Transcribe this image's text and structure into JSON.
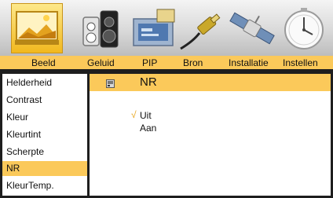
{
  "tabs": [
    "Beeld",
    "Geluid",
    "PIP",
    "Bron",
    "Installatie",
    "Instellen"
  ],
  "menu": {
    "items": [
      "Helderheid",
      "Contrast",
      "Kleur",
      "Kleurtint",
      "Scherpte",
      "NR",
      "KleurTemp."
    ],
    "selected_index": 5
  },
  "detail": {
    "title": "NR",
    "options": [
      "Uit",
      "Aan"
    ],
    "checked_index": 0,
    "check_mark": "√"
  },
  "colors": {
    "accent": "#fbc95a",
    "frame": "#1e1e1e",
    "check": "#e8a317"
  },
  "icons": [
    "picture-icon",
    "speaker-icon",
    "pip-icon",
    "connector-icon",
    "satellite-icon",
    "clock-icon"
  ]
}
